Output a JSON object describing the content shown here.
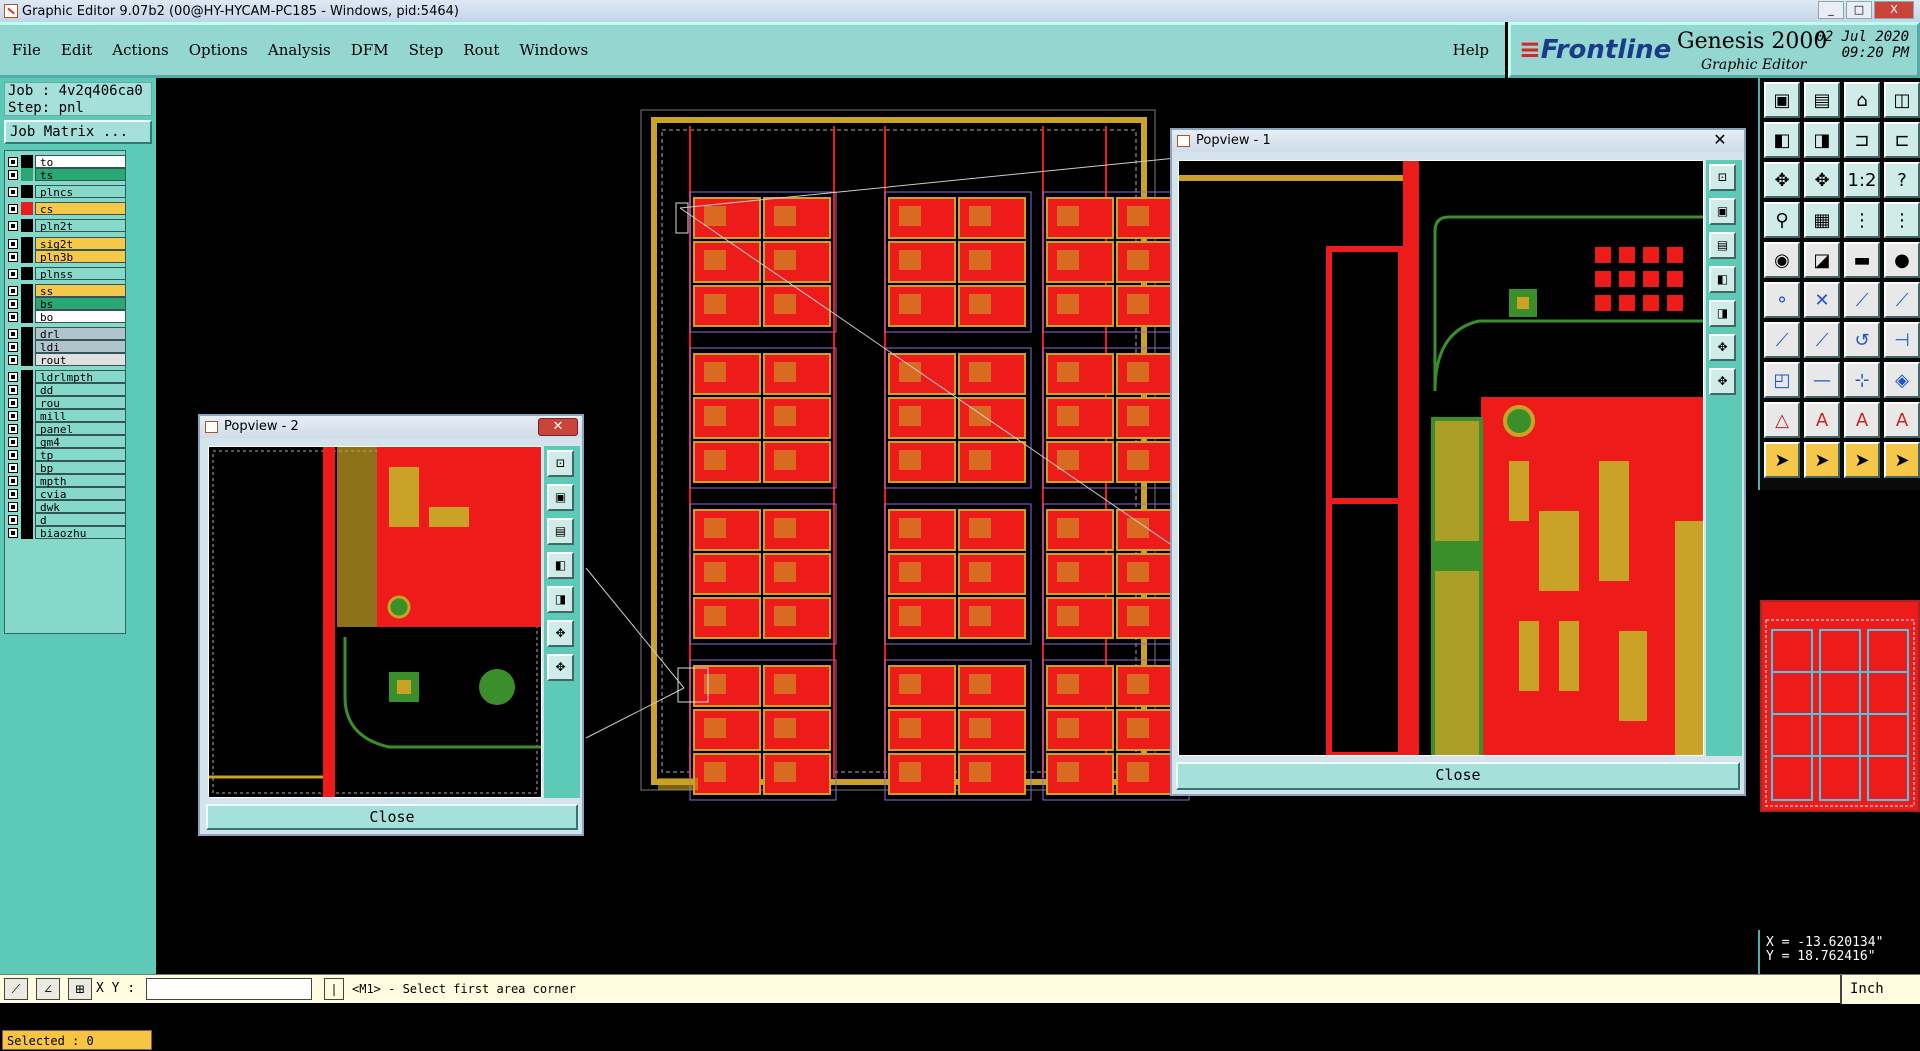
{
  "window": {
    "title": "Graphic Editor 9.07b2 (00@HY-HYCAM-PC185 - Windows, pid:5464)",
    "controls": [
      "_",
      "□",
      "X"
    ]
  },
  "menu": {
    "items": [
      "File",
      "Edit",
      "Actions",
      "Options",
      "Analysis",
      "DFM",
      "Step",
      "Rout",
      "Windows"
    ],
    "help": "Help"
  },
  "brand": {
    "logo": "Frontline",
    "product": "Genesis 2000",
    "subtitle": "Graphic Editor",
    "date": "02 Jul 2020",
    "time": "09:20 PM"
  },
  "job": {
    "job_line": "Job : 4v2q406ca0",
    "step_line": "Step: pnl",
    "matrix_button": "Job Matrix ..."
  },
  "layers": [
    {
      "name": "to",
      "color": "#ffffff",
      "swatch": "#000000"
    },
    {
      "name": "ts",
      "color": "#2aa775",
      "swatch": "#2aa775"
    },
    {
      "name": "plncs",
      "color": "#86d8c9",
      "swatch": ""
    },
    {
      "name": "cs",
      "color": "#f5c84a",
      "swatch": "#ee1b1b"
    },
    {
      "name": "pln2t",
      "color": "#86d8c9",
      "swatch": ""
    },
    {
      "name": "sig2t",
      "color": "#f5c84a",
      "swatch": ""
    },
    {
      "name": "pln3b",
      "color": "#f5c84a",
      "swatch": ""
    },
    {
      "name": "plnss",
      "color": "#86d8c9",
      "swatch": ""
    },
    {
      "name": "ss",
      "color": "#f5c84a",
      "swatch": ""
    },
    {
      "name": "bs",
      "color": "#2aa775",
      "swatch": ""
    },
    {
      "name": "bo",
      "color": "#ffffff",
      "swatch": ""
    },
    {
      "name": "drl",
      "color": "#b0c4cc",
      "swatch": ""
    },
    {
      "name": "ldi",
      "color": "#b0c4cc",
      "swatch": ""
    },
    {
      "name": "rout",
      "color": "#e0e0e0",
      "swatch": ""
    },
    {
      "name": "ldrlmpth",
      "color": "#86d8c9",
      "swatch": ""
    },
    {
      "name": "dd",
      "color": "#86d8c9",
      "swatch": ""
    },
    {
      "name": "rou",
      "color": "#86d8c9",
      "swatch": ""
    },
    {
      "name": "mill",
      "color": "#86d8c9",
      "swatch": ""
    },
    {
      "name": "panel",
      "color": "#86d8c9",
      "swatch": ""
    },
    {
      "name": "gm4",
      "color": "#86d8c9",
      "swatch": ""
    },
    {
      "name": "tp",
      "color": "#86d8c9",
      "swatch": ""
    },
    {
      "name": "bp",
      "color": "#86d8c9",
      "swatch": ""
    },
    {
      "name": "mpth",
      "color": "#86d8c9",
      "swatch": ""
    },
    {
      "name": "cvia",
      "color": "#86d8c9",
      "swatch": ""
    },
    {
      "name": "dwk",
      "color": "#86d8c9",
      "swatch": ""
    },
    {
      "name": "d",
      "color": "#86d8c9",
      "swatch": ""
    },
    {
      "name": "biaozhu",
      "color": "#86d8c9",
      "swatch": ""
    }
  ],
  "selected_label": "Selected : 0",
  "popview1": {
    "title": "Popview - 1",
    "close_label": "Close"
  },
  "popview2": {
    "title": "Popview - 2",
    "close_label": "Close"
  },
  "coords": {
    "x": "X = -13.620134\"",
    "y": "Y = 18.762416\""
  },
  "status": {
    "xy_label": "X Y :",
    "message": "<M1> - Select first area corner",
    "units": "Inch"
  },
  "colors": {
    "background": "#000000",
    "copper": "#ee1b1b",
    "pad": "#c9a227",
    "mask": "#3b8f2b",
    "panel_ui": "#5dc9b7"
  }
}
